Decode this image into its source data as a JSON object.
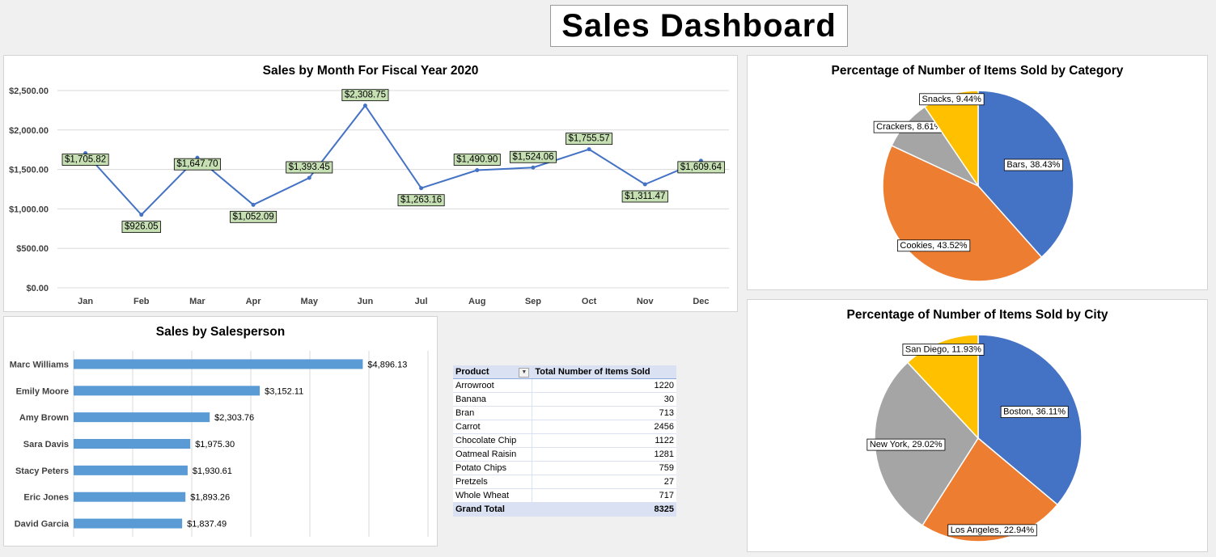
{
  "dashboard_title": "Sales Dashboard",
  "colors": {
    "line": "#4472c4",
    "data_label_bg": "#c6e0b4",
    "bar": "#5b9bd5",
    "pie": [
      "#4472c4",
      "#ed7d31",
      "#a5a5a5",
      "#ffc000"
    ]
  },
  "chart_data": [
    {
      "type": "line",
      "title": "Sales by Month For Fiscal Year 2020",
      "categories": [
        "Jan",
        "Feb",
        "Mar",
        "Apr",
        "May",
        "Jun",
        "Jul",
        "Aug",
        "Sep",
        "Oct",
        "Nov",
        "Dec"
      ],
      "values": [
        1705.82,
        926.05,
        1647.7,
        1052.09,
        1393.45,
        2308.75,
        1263.16,
        1490.9,
        1524.06,
        1755.57,
        1311.47,
        1609.64
      ],
      "data_labels": [
        "$1,705.82",
        "$926.05",
        "$1,647.70",
        "$1,052.09",
        "$1,393.45",
        "$2,308.75",
        "$1,263.16",
        "$1,490.90",
        "$1,524.06",
        "$1,755.57",
        "$1,311.47",
        "$1,609.64"
      ],
      "ylim": [
        0,
        2500
      ],
      "yticks": [
        "$0.00",
        "$500.00",
        "$1,000.00",
        "$1,500.00",
        "$2,000.00",
        "$2,500.00"
      ],
      "grid": true
    },
    {
      "type": "bar",
      "orientation": "horizontal",
      "title": "Sales by Salesperson",
      "categories": [
        "Marc Williams",
        "Emily Moore",
        "Amy Brown",
        "Sara Davis",
        "Stacy Peters",
        "Eric Jones",
        "David Garcia"
      ],
      "values": [
        4896.13,
        3152.11,
        2303.76,
        1975.3,
        1930.61,
        1893.26,
        1837.49
      ],
      "data_labels": [
        "$4,896.13",
        "$3,152.11",
        "$2,303.76",
        "$1,975.30",
        "$1,930.61",
        "$1,893.26",
        "$1,837.49"
      ],
      "xlim": [
        0,
        6000
      ],
      "grid": true
    },
    {
      "type": "pie",
      "title": "Percentage of Number of Items Sold by Category",
      "categories": [
        "Bars",
        "Cookies",
        "Crackers",
        "Snacks"
      ],
      "values": [
        38.43,
        43.52,
        8.61,
        9.44
      ],
      "data_labels": [
        "Bars, 38.43%",
        "Cookies, 43.52%",
        "Crackers, 8.61%",
        "Snacks, 9.44%"
      ]
    },
    {
      "type": "pie",
      "title": "Percentage of Number of Items Sold by City",
      "categories": [
        "Boston",
        "Los Angeles",
        "New York",
        "San Diego"
      ],
      "values": [
        36.11,
        22.94,
        29.02,
        11.93
      ],
      "data_labels": [
        "Boston, 36.11%",
        "Los Angeles, 22.94%",
        "New York, 29.02%",
        "San Diego, 11.93%"
      ]
    }
  ],
  "pivot": {
    "headers": [
      "Product",
      "Total Number of Items Sold"
    ],
    "dropdown_icon": "filter-dropdown-icon",
    "rows": [
      {
        "product": "Arrowroot",
        "total": "1220"
      },
      {
        "product": "Banana",
        "total": "30"
      },
      {
        "product": "Bran",
        "total": "713"
      },
      {
        "product": "Carrot",
        "total": "2456"
      },
      {
        "product": "Chocolate Chip",
        "total": "1122"
      },
      {
        "product": "Oatmeal Raisin",
        "total": "1281"
      },
      {
        "product": "Potato Chips",
        "total": "759"
      },
      {
        "product": "Pretzels",
        "total": "27"
      },
      {
        "product": "Whole Wheat",
        "total": "717"
      }
    ],
    "grand_total_label": "Grand Total",
    "grand_total_value": "8325"
  }
}
